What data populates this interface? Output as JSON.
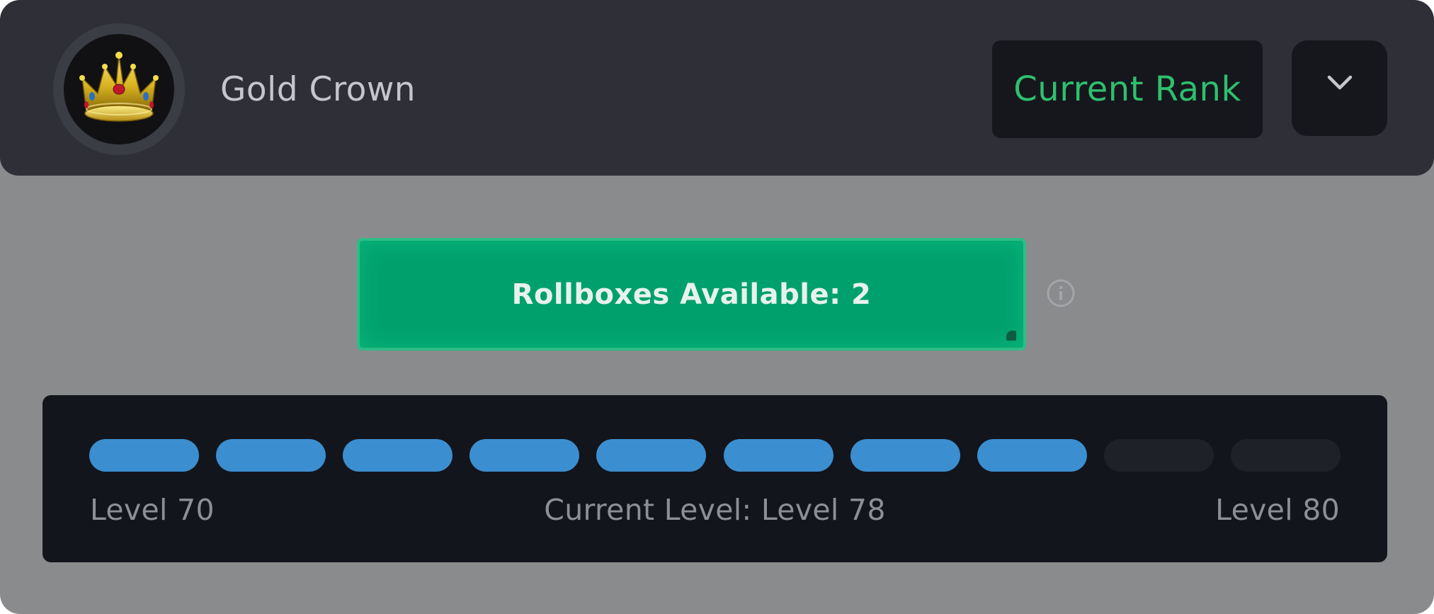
{
  "header": {
    "rank_name": "Gold Crown",
    "rank_icon": "gold-crown-icon",
    "current_rank_label": "Current Rank",
    "dropdown_icon": "chevron-down-icon"
  },
  "rollboxes": {
    "label": "Rollboxes Available: 2",
    "count": 2,
    "info_icon": "info-icon"
  },
  "progress": {
    "min_label": "Level 70",
    "current_label": "Current Level: Level 78",
    "max_label": "Level 80",
    "min_level": 70,
    "current_level": 78,
    "max_level": 80,
    "total_segments": 10,
    "filled_segments": 8
  },
  "colors": {
    "accent_green": "#2fbf6e",
    "button_green": "#00a06d",
    "progress_blue": "#3b8fd1",
    "header_bg": "#2f3037",
    "panel_bg": "#13151c"
  }
}
